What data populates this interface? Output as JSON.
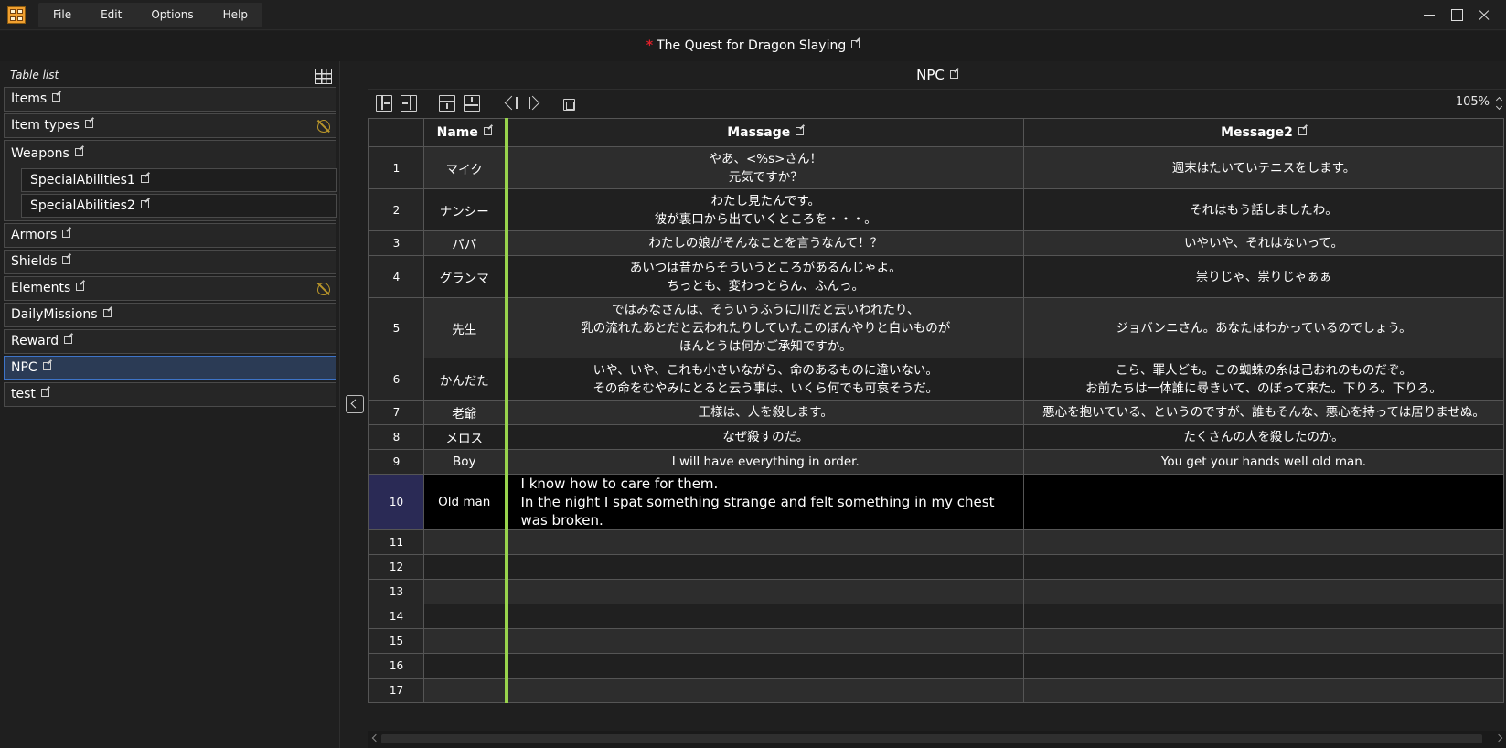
{
  "menu": [
    "File",
    "Edit",
    "Options",
    "Help"
  ],
  "project": {
    "modified_mark": "*",
    "title": "The Quest for Dragon Slaying"
  },
  "left_panel": {
    "header": "Table list",
    "items": [
      {
        "label": "Items",
        "hidden": false
      },
      {
        "label": "Item types",
        "hidden": true
      },
      {
        "label": "Weapons",
        "children": [
          "SpecialAbilities1",
          "SpecialAbilities2"
        ]
      },
      {
        "label": "Armors",
        "hidden": false
      },
      {
        "label": "Shields",
        "hidden": false
      },
      {
        "label": "Elements",
        "hidden": true
      },
      {
        "label": "DailyMissions",
        "hidden": false
      },
      {
        "label": "Reward",
        "hidden": false
      },
      {
        "label": "NPC",
        "selected": true
      },
      {
        "label": "test",
        "hidden": false
      }
    ]
  },
  "table": {
    "title": "NPC",
    "zoom": "105%",
    "columns": [
      "Name",
      "Massage",
      "Message2"
    ],
    "rows": [
      {
        "n": "1",
        "name": "マイク",
        "massage": "やあ、<%s>さん！\n元気ですか？",
        "message2": "週末はたいていテニスをします。"
      },
      {
        "n": "2",
        "name": "ナンシー",
        "massage": "わたし見たんです。\n彼が裏口から出ていくところを・・・。",
        "message2": "それはもう話しましたわ。"
      },
      {
        "n": "3",
        "name": "パパ",
        "massage": "わたしの娘がそんなことを言うなんて！？",
        "message2": "いやいや、それはないって。"
      },
      {
        "n": "4",
        "name": "グランマ",
        "massage": "あいつは昔からそういうところがあるんじゃよ。\nちっとも、変わっとらん、ふんっ。",
        "message2": "祟りじゃ、祟りじゃぁぁ"
      },
      {
        "n": "5",
        "name": "先生",
        "massage": "ではみなさんは、そういうふうに川だと云いわれたり、\n乳の流れたあとだと云われたりしていたこのぼんやりと白いものが\nほんとうは何かご承知ですか。",
        "message2": "ジョバンニさん。あなたはわかっているのでしょう。"
      },
      {
        "n": "6",
        "name": "かんだた",
        "massage": "いや、いや、これも小さいながら、命のあるものに違いない。\nその命をむやみにとると云う事は、いくら何でも可哀そうだ。",
        "message2": "こら、罪人ども。この蜘蛛の糸は己おれのものだぞ。\nお前たちは一体誰に尋きいて、のぼって来た。下りろ。下りろ。"
      },
      {
        "n": "7",
        "name": "老爺",
        "massage": "王様は、人を殺します。",
        "message2": "悪心を抱いている、というのですが、誰もそんな、悪心を持っては居りませぬ。"
      },
      {
        "n": "8",
        "name": "メロス",
        "massage": "なぜ殺すのだ。",
        "message2": "たくさんの人を殺したのか。"
      },
      {
        "n": "9",
        "name": "Boy",
        "massage": "I will have everything in order.",
        "message2": "You get your hands well old man."
      },
      {
        "n": "10",
        "name": "Old man",
        "massage": "I know how to care for them.\nIn the night I spat something strange and felt something in my chest was broken.",
        "message2": ""
      },
      {
        "n": "11",
        "name": "",
        "massage": "",
        "message2": ""
      },
      {
        "n": "12",
        "name": "",
        "massage": "",
        "message2": ""
      },
      {
        "n": "13",
        "name": "",
        "massage": "",
        "message2": ""
      },
      {
        "n": "14",
        "name": "",
        "massage": "",
        "message2": ""
      },
      {
        "n": "15",
        "name": "",
        "massage": "",
        "message2": ""
      },
      {
        "n": "16",
        "name": "",
        "massage": "",
        "message2": ""
      },
      {
        "n": "17",
        "name": "",
        "massage": "",
        "message2": ""
      }
    ]
  },
  "colors": {
    "accent_divider": "#98d34c",
    "selected_row_number": "#2a2a55",
    "selected_table": "#3e74c8",
    "modified_mark": "#e0202a",
    "hidden_icon": "#b8952a"
  }
}
